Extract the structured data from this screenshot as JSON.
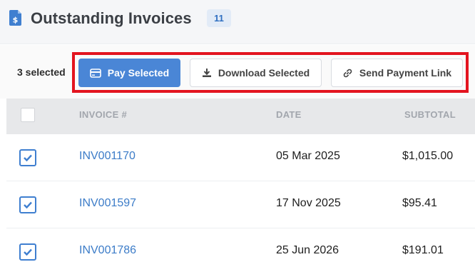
{
  "header": {
    "title": "Outstanding Invoices",
    "count_badge": "11",
    "icon": "invoice-dollar-icon"
  },
  "toolbar": {
    "selected_text": "3 selected",
    "pay_label": "Pay Selected",
    "download_label": "Download Selected",
    "send_link_label": "Send Payment Link",
    "highlight_color": "#e3141f",
    "primary_color": "#4a86d6"
  },
  "table": {
    "columns": [
      "INVOICE #",
      "DATE",
      "SUBTOTAL"
    ],
    "rows": [
      {
        "invoice": "INV001170",
        "date": "05 Mar 2025",
        "subtotal": "$1,015.00",
        "checked": true
      },
      {
        "invoice": "INV001597",
        "date": "17 Nov 2025",
        "subtotal": "$95.41",
        "checked": true
      },
      {
        "invoice": "INV001786",
        "date": "25 Jun 2026",
        "subtotal": "$191.01",
        "checked": true
      }
    ]
  }
}
